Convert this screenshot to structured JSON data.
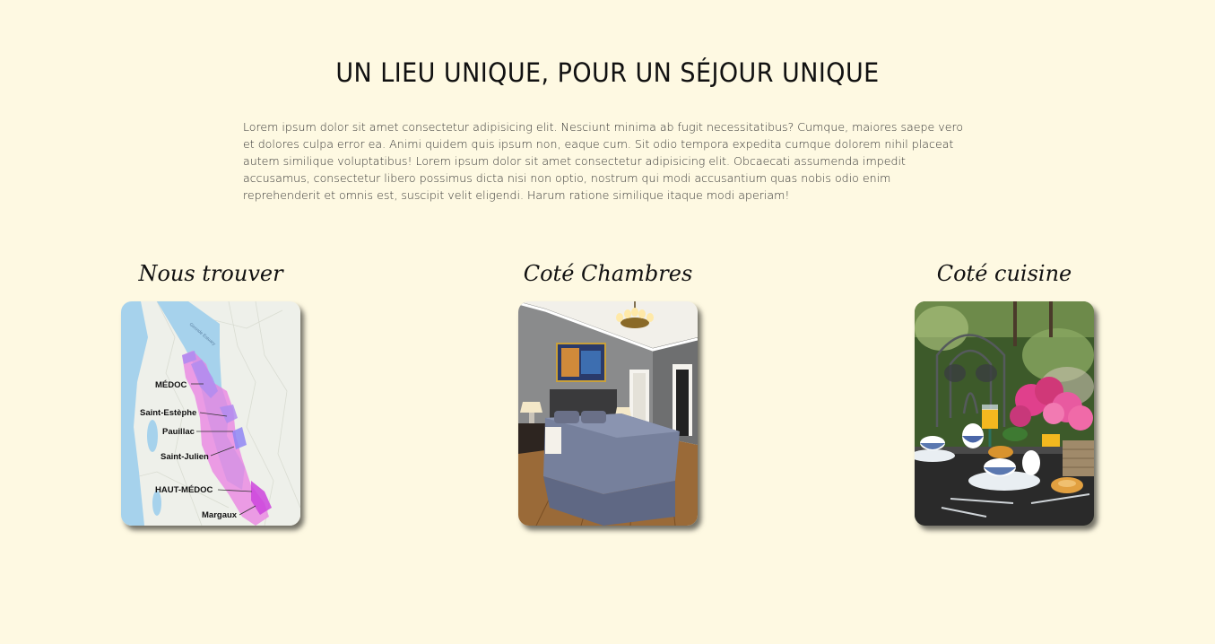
{
  "section": {
    "title": "UN LIEU UNIQUE, POUR UN SÉJOUR UNIQUE",
    "intro": "Lorem ipsum dolor sit amet consectetur adipisicing elit. Nesciunt minima ab fugit necessitatibus? Cumque, maiores saepe vero et dolores culpa error ea. Animi quidem quis ipsum non, eaque cum. Sit odio tempora expedita cumque dolorem nihil placeat autem similique voluptatibus! Lorem ipsum dolor sit amet consectetur adipisicing elit. Obcaecati assumenda impedit accusamus, consectetur libero possimus dicta nisi non optio, nostrum qui modi accusantium quas nobis odio enim reprehenderit et omnis est, suscipit velit eligendi. Harum ratione similique itaque modi aperiam!"
  },
  "cards": {
    "map": {
      "title": "Nous trouver",
      "labels": {
        "medoc": "MÉDOC",
        "saint_estephe": "Saint-Estèphe",
        "pauillac": "Pauillac",
        "saint_julien": "Saint-Julien",
        "haut_medoc": "HAUT-MÉDOC",
        "margaux": "Margaux",
        "river": "Gironde Estuary"
      }
    },
    "rooms": {
      "title": "Coté Chambres"
    },
    "kitchen": {
      "title": "Coté cuisine"
    }
  },
  "colors": {
    "background": "#fef9e2",
    "text": "#222222"
  }
}
